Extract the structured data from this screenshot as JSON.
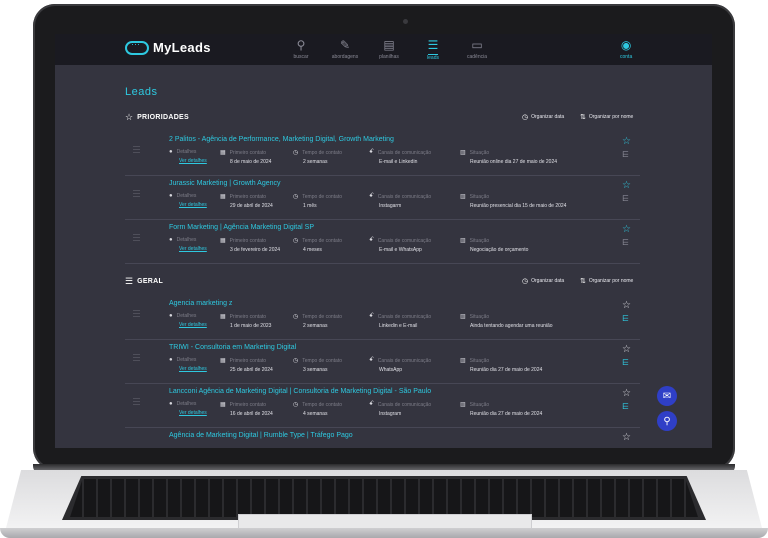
{
  "app": {
    "brand": "MyLeads",
    "nav": [
      {
        "label": "buscar",
        "icon": "search-icon",
        "active": false
      },
      {
        "label": "abordagens",
        "icon": "pen-icon",
        "active": false
      },
      {
        "label": "planilhas",
        "icon": "sheet-icon",
        "active": false
      },
      {
        "label": "leads",
        "icon": "checklist-icon",
        "active": true
      },
      {
        "label": "cadência",
        "icon": "chat-icon",
        "active": false
      }
    ],
    "account_label": "conta"
  },
  "page": {
    "title": "Leads",
    "sort_by_date": "Organizar data",
    "sort_by_name": "Organizar por nome"
  },
  "labels": {
    "details": "Detalhes",
    "see_details": "Ver detalhes",
    "first_contact": "Primeiro contato",
    "contact_time": "Tempo de contato",
    "channels": "Canais de comunicação",
    "status": "Situação"
  },
  "priorities": {
    "title": "PRIORIDADES",
    "leads": [
      {
        "name": "2 Palitos - Agência de Performance, Marketing Digital, Growth Marketing",
        "first_contact": "8 de maio de 2024",
        "contact_time": "2 semanas",
        "channels": "E-mail e Linkedin",
        "status": "Reunião online dia 27 de maio de 2024"
      },
      {
        "name": "Jurassic Marketing | Growth Agency",
        "first_contact": "29 de abril de 2024",
        "contact_time": "1 mês",
        "channels": "Instagarm",
        "status": "Reunião presencial dia 15 de maio de 2024"
      },
      {
        "name": "Form Marketing | Agência Marketing Digital SP",
        "first_contact": "3 de fevereiro de 2024",
        "contact_time": "4 meses",
        "channels": "E-mail e WhatsApp",
        "status": "Negociação de orçamento"
      }
    ]
  },
  "general": {
    "title": "GERAL",
    "leads": [
      {
        "name": "Agencia marketing z",
        "first_contact": "1 de maio de 2023",
        "contact_time": "2 semanas",
        "channels": "Linkedin e E-mail",
        "status": "Ainda tentando agendar uma reunião"
      },
      {
        "name": "TRIWI - Consultoria em Marketing Digital",
        "first_contact": "25 de abril de 2024",
        "contact_time": "3 semanas",
        "channels": "WhatsApp",
        "status": "Reunião dia 27 de maio de 2024"
      },
      {
        "name": "Lancconi Agência de Marketing Digital | Consultoria de Marketing Digital - São Paulo",
        "first_contact": "16 de abril de 2024",
        "contact_time": "4 semanas",
        "channels": "Instagram",
        "status": "Reunião dia 27 de maio de 2024"
      },
      {
        "name": "Agência de Marketing Digital | Rumble Type | Tráfego Pago"
      }
    ]
  },
  "colors": {
    "accent": "#2ec9e0",
    "background": "#34343f",
    "topbar": "#1a1a21",
    "fab": "#2f3fc7"
  }
}
